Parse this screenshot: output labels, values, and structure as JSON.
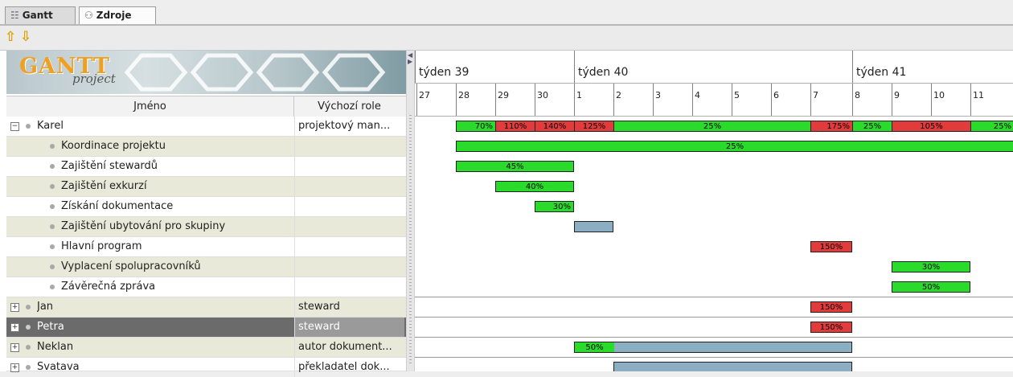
{
  "tabs": [
    {
      "label": "Gantt",
      "icon": "gantt-icon",
      "active": false
    },
    {
      "label": "Zdroje",
      "icon": "resources-icon",
      "active": true
    }
  ],
  "toolbar": {
    "up_icon": "arrow-up-icon",
    "down_icon": "arrow-down-icon"
  },
  "logo": {
    "title": "GANTT",
    "subtitle": "project"
  },
  "table": {
    "headers": {
      "name": "Jméno",
      "role": "Výchozí role"
    },
    "rows": [
      {
        "name": "Karel",
        "role": "projektový man...",
        "level": 0,
        "expander": "−"
      },
      {
        "name": "Koordinace projektu",
        "role": "",
        "level": 1
      },
      {
        "name": "Zajištění stewardů",
        "role": "",
        "level": 1
      },
      {
        "name": "Zajištění exkurzí",
        "role": "",
        "level": 1
      },
      {
        "name": "Získání dokumentace",
        "role": "",
        "level": 1
      },
      {
        "name": "Zajištění ubytování pro skupiny",
        "role": "",
        "level": 1
      },
      {
        "name": "Hlavní program",
        "role": "",
        "level": 1
      },
      {
        "name": "Vyplacení spolupracovníků",
        "role": "",
        "level": 1
      },
      {
        "name": "Závěrečná zpráva",
        "role": "",
        "level": 1
      },
      {
        "name": "Jan",
        "role": "steward",
        "level": 0,
        "expander": "+"
      },
      {
        "name": "Petra",
        "role": "steward",
        "level": 0,
        "expander": "+",
        "selected": true
      },
      {
        "name": "Neklan",
        "role": "autor dokument...",
        "level": 0,
        "expander": "+"
      },
      {
        "name": "Svatava",
        "role": "překladatel dok...",
        "level": 0,
        "expander": "+"
      }
    ]
  },
  "timeline": {
    "weeks": [
      "týden 39",
      "týden 40",
      "týden 41"
    ],
    "days": [
      "27",
      "28",
      "29",
      "30",
      "1",
      "2",
      "3",
      "4",
      "5",
      "6",
      "7",
      "8",
      "9",
      "10",
      "11"
    ]
  },
  "loads": {
    "karel": [
      "70%",
      "110%",
      "140%",
      "125%",
      "25%",
      "175%",
      "25%",
      "105%",
      "25%"
    ],
    "tasks": [
      "25%",
      "45%",
      "40%",
      "30%",
      "",
      "150%",
      "30%",
      "50%"
    ],
    "jan": "150%",
    "petra": "150%",
    "neklan": "50%",
    "svatava": ""
  },
  "colors": {
    "ok": "#2bdb2b",
    "overload": "#e23b3b",
    "idle": "#8caec2",
    "selected_row": "#6b6b6b"
  }
}
